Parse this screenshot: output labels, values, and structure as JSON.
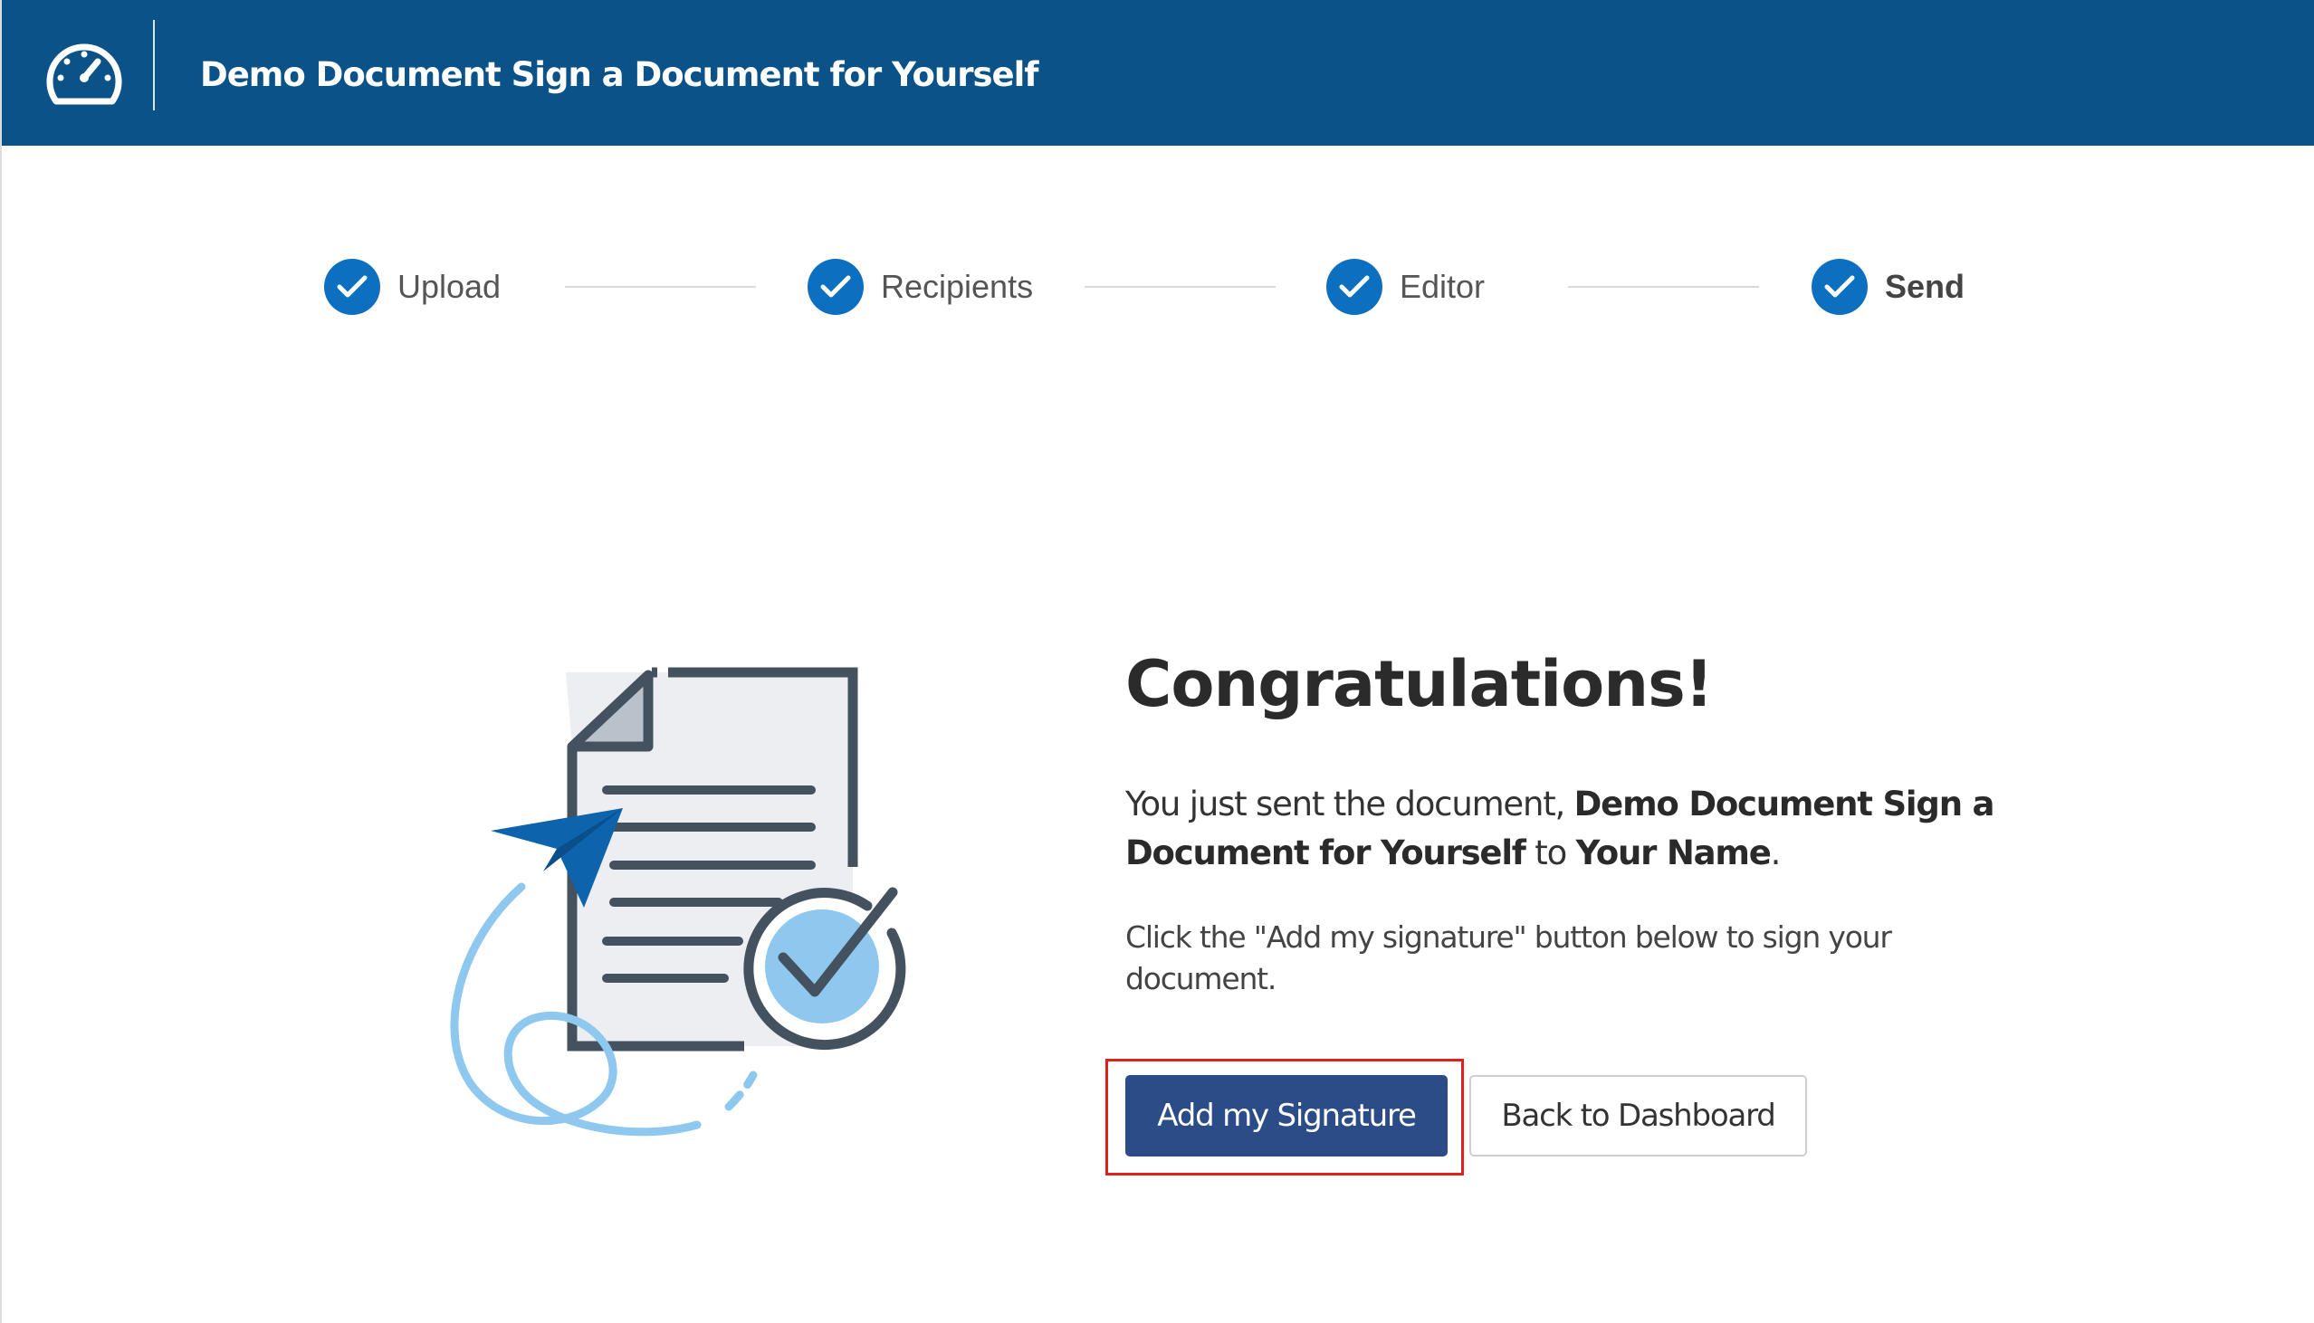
{
  "header": {
    "logo_icon": "speedometer-icon",
    "title": "Demo Document Sign a Document for Yourself",
    "background_color": "#0a5287"
  },
  "stepper": {
    "steps": [
      {
        "label": "Upload",
        "status": "complete",
        "icon": "check-icon"
      },
      {
        "label": "Recipients",
        "status": "complete",
        "icon": "check-icon"
      },
      {
        "label": "Editor",
        "status": "complete",
        "icon": "check-icon"
      },
      {
        "label": "Send",
        "status": "current",
        "icon": "check-icon"
      }
    ],
    "accent_color": "#0d6fc0"
  },
  "illustration": {
    "icon": "document-sent-check-illustration"
  },
  "main": {
    "heading": "Congratulations!",
    "sent_prefix": "You just sent the document, ",
    "document_name": "Demo Document Sign a Document for Yourself",
    "sent_to": " to ",
    "recipient_name": "Your Name",
    "sent_suffix": ".",
    "instruction": "Click the \"Add my signature\" button below to sign your document."
  },
  "actions": {
    "primary_label": "Add my Signature",
    "secondary_label": "Back to Dashboard",
    "primary_color": "#2b4c86",
    "highlight_color": "#e01f1f"
  }
}
